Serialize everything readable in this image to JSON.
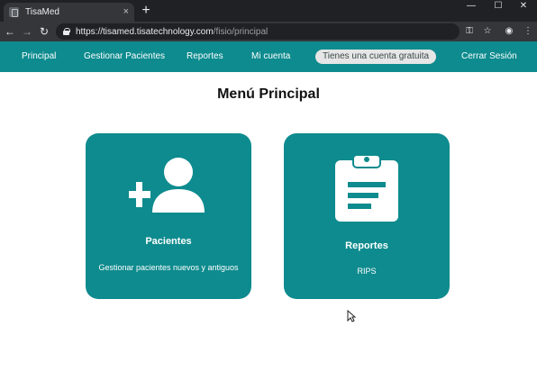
{
  "browser": {
    "tab_title": "TisaMed",
    "tab_close": "×",
    "new_tab": "+",
    "window_controls": {
      "minimize": "—",
      "maximize": "☐",
      "close": "✕"
    },
    "url_host": "https://tisamed.tisatechnology.com",
    "url_path": "/fisio/principal",
    "nav": {
      "back": "←",
      "forward": "→",
      "reload": "↻"
    },
    "icons": {
      "key": "⚿",
      "star": "☆",
      "extension": "◉",
      "menu": "⋮"
    }
  },
  "nav": {
    "items": [
      "Principal",
      "Gestionar Pacientes",
      "Reportes",
      "Mi cuenta"
    ],
    "account_badge": "Tienes una cuenta gratuita",
    "logout": "Cerrar Sesión"
  },
  "main": {
    "title": "Menú Principal",
    "cards": [
      {
        "title": "Pacientes",
        "description": "Gestionar pacientes nuevos y antiguos",
        "icon": "add-user-icon"
      },
      {
        "title": "Reportes",
        "description": "RIPS",
        "icon": "clipboard-icon"
      }
    ]
  },
  "colors": {
    "brand": "#0e8b8e",
    "chrome_dark": "#202124",
    "chrome_toolbar": "#35363a"
  }
}
